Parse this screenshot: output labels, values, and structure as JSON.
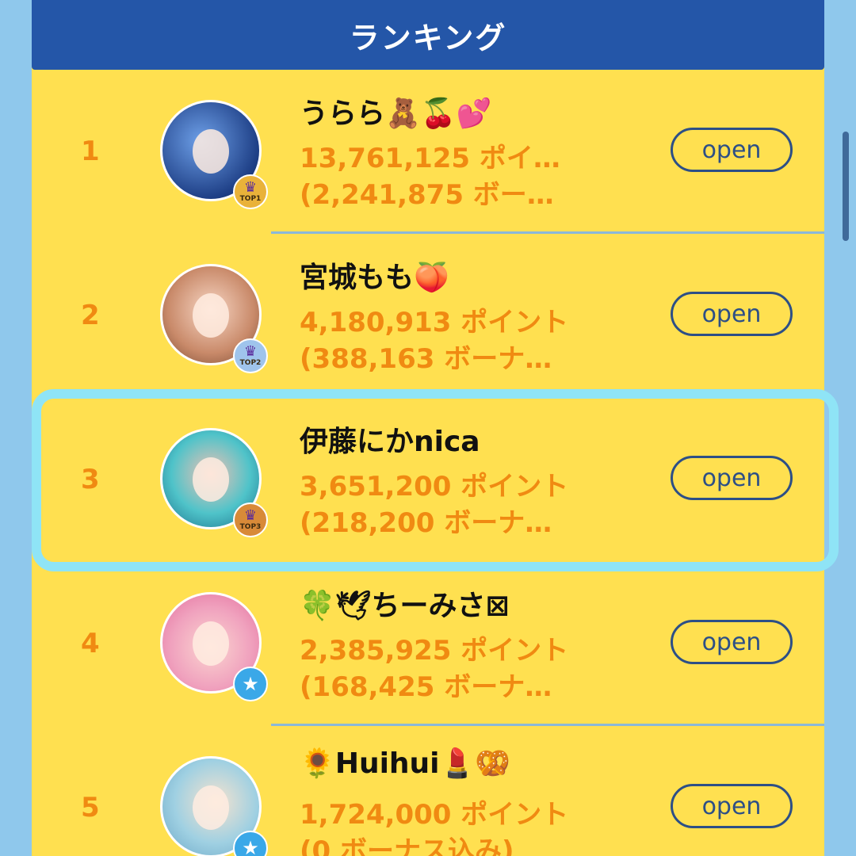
{
  "header": {
    "title": "ランキング"
  },
  "rows": [
    {
      "rank": "1",
      "name": "うらら🧸🍒💕",
      "points": "13,761,125 ポイ…",
      "bonus": "(2,241,875 ボー…",
      "badge": "TOP1",
      "open_label": "open"
    },
    {
      "rank": "2",
      "name": "宮城もも🍑",
      "points": "4,180,913 ポイント",
      "bonus": "(388,163 ボーナ…",
      "badge": "TOP2",
      "open_label": "open"
    },
    {
      "rank": "3",
      "name": "伊藤にかnica",
      "points": "3,651,200 ポイント",
      "bonus": "(218,200 ボーナ…",
      "badge": "TOP3",
      "open_label": "open"
    },
    {
      "rank": "4",
      "name": "🍀🕊ちーみさ⊠",
      "points": "2,385,925 ポイント",
      "bonus": "(168,425 ボーナ…",
      "badge": "",
      "open_label": "open"
    },
    {
      "rank": "5",
      "name": "🌻Huihui💄🥨",
      "points": "1,724,000 ポイント",
      "bonus": "(0 ボーナス込み)",
      "badge": "",
      "open_label": "open"
    }
  ],
  "highlighted_rank": "3"
}
